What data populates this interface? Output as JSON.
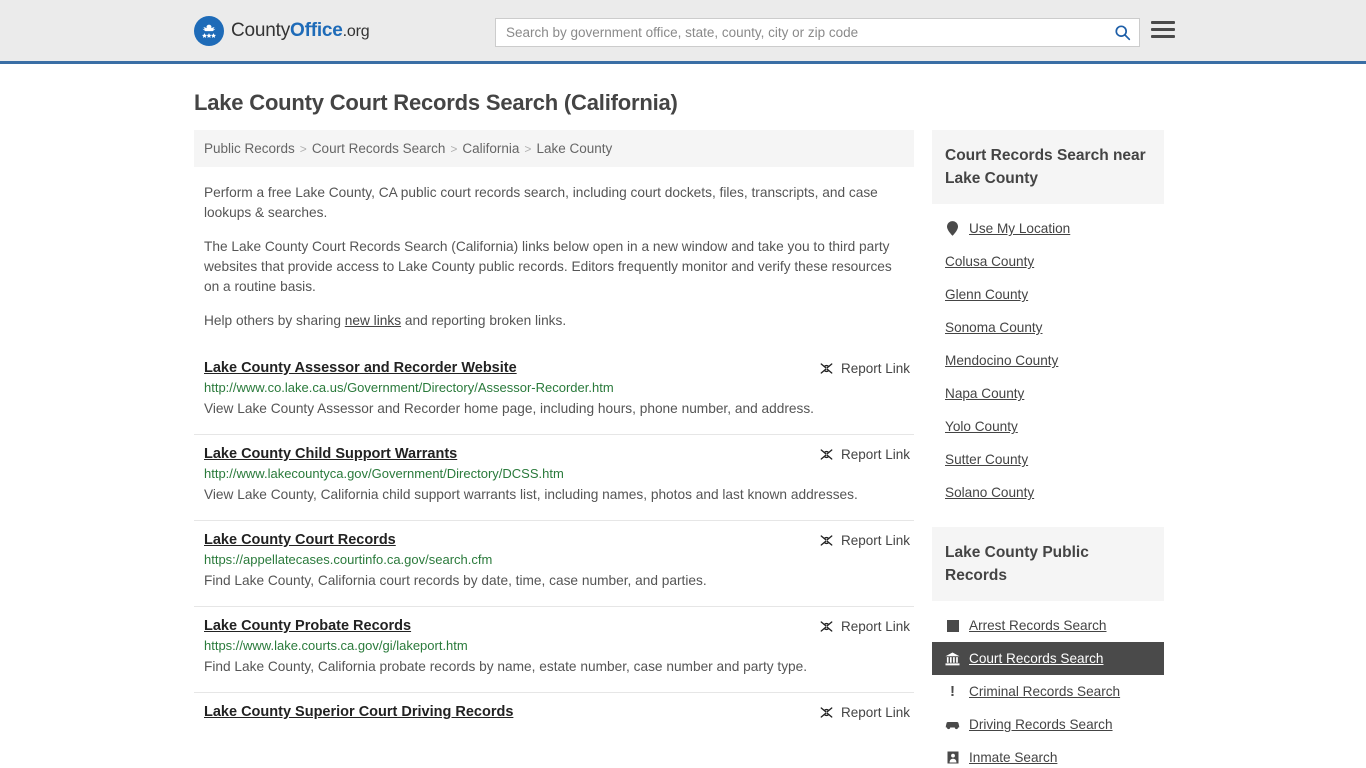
{
  "header": {
    "logo": {
      "part1": "County",
      "part2": "Office",
      "part3": ".org",
      "emblem_icon": "eagle-emblem"
    },
    "search": {
      "placeholder": "Search by government office, state, county, city or zip code",
      "value": "",
      "icon": "search-icon"
    },
    "menu_icon": "hamburger-menu-icon",
    "accent_color": "#1e6bb8",
    "border_color": "#3a6ea5",
    "background": "#ebebeb"
  },
  "page_title": "Lake County Court Records Search (California)",
  "breadcrumb": {
    "separator": ">",
    "items": [
      {
        "label": "Public Records"
      },
      {
        "label": "Court Records Search"
      },
      {
        "label": "California"
      },
      {
        "label": "Lake County"
      }
    ]
  },
  "intro": {
    "p1": "Perform a free Lake County, CA public court records search, including court dockets, files, transcripts, and case lookups & searches.",
    "p2": "The Lake County Court Records Search (California) links below open in a new window and take you to third party websites that provide access to Lake County public records. Editors frequently monitor and verify these resources on a routine basis.",
    "p3_before": "Help others by sharing ",
    "p3_link": "new links",
    "p3_after": " and reporting broken links."
  },
  "results": {
    "report_label": "Report Link",
    "report_icon": "broken-link-icon",
    "url_color": "#2a7a3b",
    "items": [
      {
        "title": "Lake County Assessor and Recorder Website",
        "url": "http://www.co.lake.ca.us/Government/Directory/Assessor-Recorder.htm",
        "description": "View Lake County Assessor and Recorder home page, including hours, phone number, and address."
      },
      {
        "title": "Lake County Child Support Warrants",
        "url": "http://www.lakecountyca.gov/Government/Directory/DCSS.htm",
        "description": "View Lake County, California child support warrants list, including names, photos and last known addresses."
      },
      {
        "title": "Lake County Court Records",
        "url": "https://appellatecases.courtinfo.ca.gov/search.cfm",
        "description": "Find Lake County, California court records by date, time, case number, and parties."
      },
      {
        "title": "Lake County Probate Records",
        "url": "https://www.lake.courts.ca.gov/gi/lakeport.htm",
        "description": "Find Lake County, California probate records by name, estate number, case number and party type."
      },
      {
        "title": "Lake County Superior Court Driving Records",
        "url": "",
        "description": ""
      }
    ]
  },
  "sidebar": {
    "nearby": {
      "heading": "Court Records Search near Lake County",
      "items": [
        {
          "label": "Use My Location",
          "icon": "map-pin-icon"
        },
        {
          "label": "Colusa County",
          "icon": ""
        },
        {
          "label": "Glenn County",
          "icon": ""
        },
        {
          "label": "Sonoma County",
          "icon": ""
        },
        {
          "label": "Mendocino County",
          "icon": ""
        },
        {
          "label": "Napa County",
          "icon": ""
        },
        {
          "label": "Yolo County",
          "icon": ""
        },
        {
          "label": "Sutter County",
          "icon": ""
        },
        {
          "label": "Solano County",
          "icon": ""
        }
      ]
    },
    "public_records": {
      "heading": "Lake County Public Records",
      "active_background": "#4a4a4a",
      "items": [
        {
          "label": "Arrest Records Search",
          "icon": "fingerprint-icon",
          "active": false
        },
        {
          "label": "Court Records Search",
          "icon": "courthouse-icon",
          "active": true
        },
        {
          "label": "Criminal Records Search",
          "icon": "exclamation-icon",
          "active": false
        },
        {
          "label": "Driving Records Search",
          "icon": "car-icon",
          "active": false
        },
        {
          "label": "Inmate Search",
          "icon": "inmate-icon",
          "active": false
        }
      ]
    }
  }
}
